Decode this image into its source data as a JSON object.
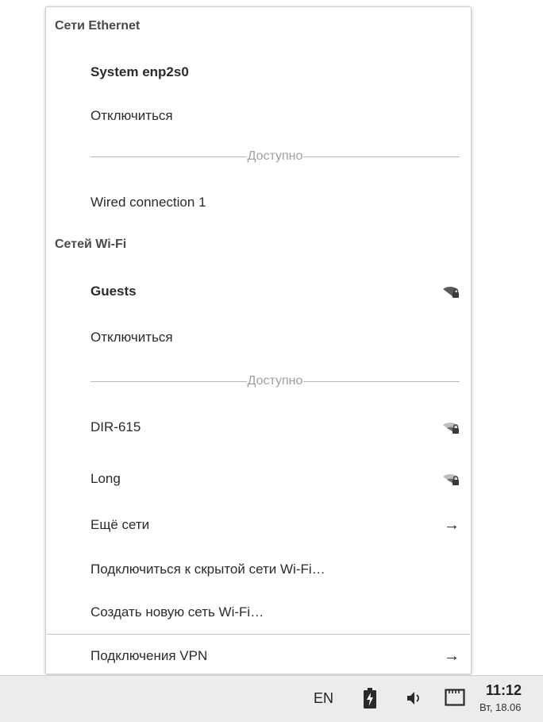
{
  "ethernet": {
    "header": "Сети Ethernet",
    "active": "System enp2s0",
    "disconnect": "Отключиться",
    "available_label": "Доступно",
    "available": [
      "Wired connection 1"
    ]
  },
  "wifi": {
    "header": "Сетей Wi-Fi",
    "active": {
      "name": "Guests",
      "icon": "wifi-secured-icon"
    },
    "disconnect": "Отключиться",
    "available_label": "Доступно",
    "available": [
      {
        "name": "DIR-615",
        "icon": "wifi-secured-weak-icon"
      },
      {
        "name": "Long",
        "icon": "wifi-secured-weak-icon"
      }
    ],
    "more": "Ещё сети",
    "connect_hidden": "Подключиться к скрытой сети Wi-Fi…",
    "create_new": "Создать новую сеть Wi-Fi…"
  },
  "vpn": {
    "label": "Подключения VPN"
  },
  "taskbar": {
    "keyboard_layout": "EN",
    "time": "11:12",
    "date": "Вт, 18.06"
  },
  "colors": {
    "menu_bg": "#ffffff",
    "taskbar_bg": "#ececec",
    "separator": "#b8b8b8",
    "header_text": "#4a4a4a"
  }
}
